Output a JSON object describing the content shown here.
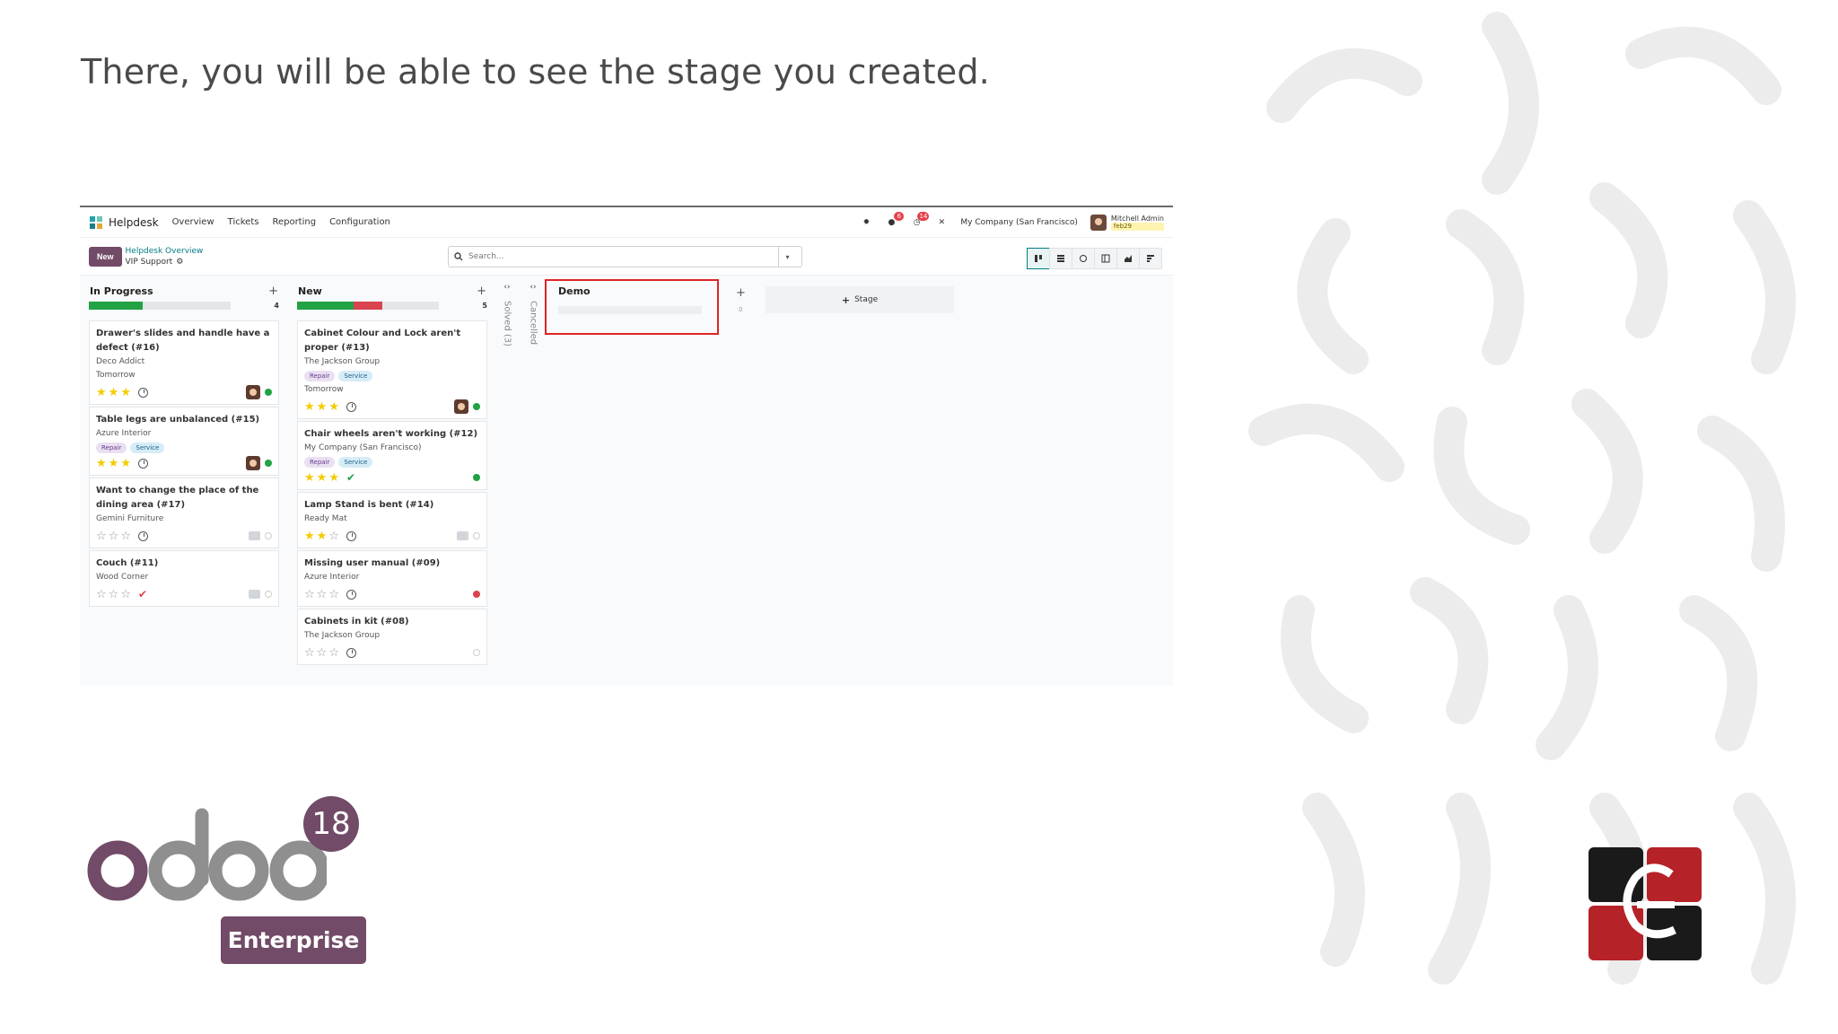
{
  "slide": {
    "title": "There, you will be able to see the stage you created.",
    "version": "18",
    "edition": "Enterprise"
  },
  "navbar": {
    "app_name": "Helpdesk",
    "menu": [
      "Overview",
      "Tickets",
      "Reporting",
      "Configuration"
    ],
    "chat_count": "6",
    "activity_count": "14",
    "company": "My Company (San Francisco)",
    "user_name": "Mitchell Admin",
    "user_tag": "feb29"
  },
  "control": {
    "new_label": "New",
    "breadcrumb_parent": "Helpdesk Overview",
    "breadcrumb_current": "VIP Support",
    "search_placeholder": "Search..."
  },
  "columns": [
    {
      "title": "In Progress",
      "count": "4",
      "progress": [
        {
          "color": "#21a244",
          "fraction": 0.38
        }
      ],
      "cards": [
        {
          "title": "Drawer's slides and handle have a defect (#16)",
          "customer": "Deco Addict",
          "deadline": "Tomorrow",
          "tags": [],
          "stars": 3,
          "status": "clock",
          "avatar": true,
          "dot": "green"
        },
        {
          "title": "Table legs are unbalanced (#15)",
          "customer": "Azure Interior",
          "deadline": "",
          "tags": [
            "Repair",
            "Service"
          ],
          "stars": 3,
          "status": "clock",
          "avatar": true,
          "dot": "green"
        },
        {
          "title": "Want to change the place of the dining area (#17)",
          "customer": "Gemini Furniture",
          "deadline": "",
          "tags": [],
          "stars": 0,
          "status": "clock",
          "avatar": false,
          "dot": "grey"
        },
        {
          "title": "Couch (#11)",
          "customer": "Wood Corner",
          "deadline": "",
          "tags": [],
          "stars": 0,
          "status": "check-red",
          "avatar": false,
          "dot": "grey"
        }
      ]
    },
    {
      "title": "New",
      "count": "5",
      "progress": [
        {
          "color": "#21a244",
          "fraction": 0.4
        },
        {
          "color": "#d9434f",
          "fraction": 0.2
        }
      ],
      "cards": [
        {
          "title": "Cabinet Colour and Lock aren't proper (#13)",
          "customer": "The Jackson Group",
          "deadline": "Tomorrow",
          "tags": [
            "Repair",
            "Service"
          ],
          "stars": 3,
          "status": "clock",
          "avatar": true,
          "dot": "green"
        },
        {
          "title": "Chair wheels aren't working (#12)",
          "customer": "My Company (San Francisco)",
          "deadline": "",
          "tags": [
            "Repair",
            "Service"
          ],
          "stars": 3,
          "status": "check-green",
          "avatar": false,
          "dot": "green"
        },
        {
          "title": "Lamp Stand is bent (#14)",
          "customer": "Ready Mat",
          "deadline": "",
          "tags": [],
          "stars": 2,
          "status": "clock",
          "avatar": false,
          "dot": "grey-cam"
        },
        {
          "title": "Missing user manual (#09)",
          "customer": "Azure Interior",
          "deadline": "",
          "tags": [],
          "stars": 0,
          "status": "clock",
          "avatar": false,
          "dot": "red"
        },
        {
          "title": "Cabinets in kit (#08)",
          "customer": "The Jackson Group",
          "deadline": "",
          "tags": [],
          "stars": 0,
          "status": "clock",
          "avatar": false,
          "dot": "grey"
        }
      ]
    }
  ],
  "folded": [
    {
      "label": "Solved (3)"
    },
    {
      "label": "Cancelled"
    }
  ],
  "demo_column": {
    "title": "Demo",
    "count": "0"
  },
  "add_stage_label": "Stage",
  "colors": {
    "brand": "#714b67",
    "link": "#017e84",
    "highlight": "#e02424"
  }
}
